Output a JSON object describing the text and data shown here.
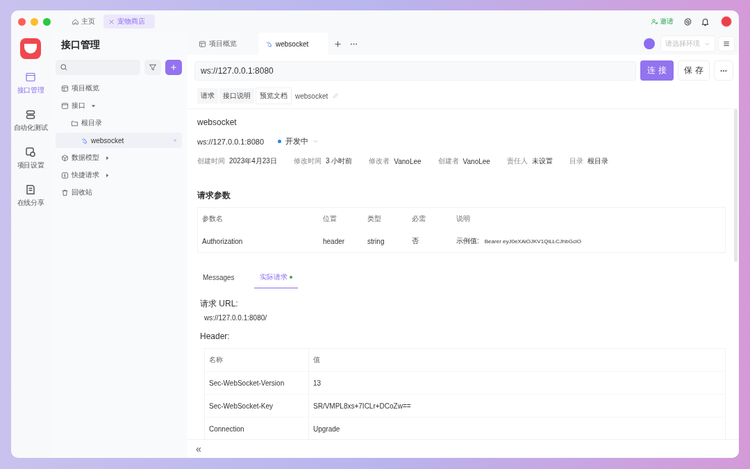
{
  "window_tabs": [
    {
      "label": "主页",
      "kind": "home",
      "selected": false
    },
    {
      "label": "宠物商店",
      "kind": "project",
      "selected": true
    }
  ],
  "header": {
    "invite": "邀请"
  },
  "rail": [
    {
      "label": "接口管理",
      "kind": "api",
      "selected": true
    },
    {
      "label": "自动化测试",
      "kind": "test",
      "selected": false
    },
    {
      "label": "项目设置",
      "kind": "settings",
      "selected": false
    },
    {
      "label": "在线分享",
      "kind": "share",
      "selected": false
    }
  ],
  "sidebar": {
    "title": "接口管理",
    "tree": [
      {
        "label": "项目概览",
        "kind": "overview",
        "selected": false
      },
      {
        "label": "接口",
        "kind": "api",
        "selected": false,
        "expanded": true,
        "children": [
          {
            "label": "根目录",
            "kind": "folder",
            "selected": false,
            "children": [
              {
                "label": "websocket",
                "kind": "websocket",
                "selected": true
              }
            ]
          }
        ]
      },
      {
        "label": "数据模型",
        "kind": "model",
        "selected": false,
        "expanded": false
      },
      {
        "label": "快捷请求",
        "kind": "quick",
        "selected": false,
        "expanded": false
      },
      {
        "label": "回收站",
        "kind": "trash",
        "selected": false
      }
    ]
  },
  "editor_tabs": [
    {
      "label": "项目概览",
      "kind": "overview",
      "selected": false
    },
    {
      "label": "websocket",
      "kind": "websocket",
      "selected": true
    }
  ],
  "environment": {
    "placeholder": "请选择环境"
  },
  "url": "ws://127.0.0.1:8080",
  "buttons": {
    "connect": "连 接",
    "save": "保 存"
  },
  "sub_tabs": [
    {
      "label": "请求",
      "selected": false
    },
    {
      "label": "接口说明",
      "selected": false
    },
    {
      "label": "预览文档",
      "selected": true
    }
  ],
  "endpoint_name": "websocket",
  "doc": {
    "title": "websocket",
    "url": "ws://127.0.0.1:8080",
    "status": {
      "label": "开发中",
      "color": "#1e88e5"
    },
    "meta": [
      {
        "label": "创建时间",
        "value": "2023年4月23日"
      },
      {
        "label": "修改时间",
        "value": "3 小时前"
      },
      {
        "label": "修改者",
        "value": "VanoLee"
      },
      {
        "label": "创建者",
        "value": "VanoLee"
      },
      {
        "label": "责任人",
        "value": "未设置"
      },
      {
        "label": "目录",
        "value": "根目录"
      }
    ]
  },
  "params": {
    "title": "请求参数",
    "columns": [
      "参数名",
      "位置",
      "类型",
      "必需",
      "说明"
    ],
    "rows": [
      {
        "name": "Authorization",
        "location": "header",
        "type": "string",
        "required": "否",
        "example_label": "示例值:",
        "example": "Bearer eyJ0eXAiOJKV1QiLLCJhbGciO"
      }
    ]
  },
  "result_tabs": [
    {
      "label": "Messages",
      "selected": false,
      "dot": false
    },
    {
      "label": "实际请求",
      "selected": true,
      "dot": true
    }
  ],
  "request": {
    "url_label": "请求 URL:",
    "url": "ws://127.0.0.1:8080/",
    "header_label": "Header:",
    "columns": [
      "名称",
      "值"
    ],
    "rows": [
      {
        "name": "Sec-WebSocket-Version",
        "value": "13"
      },
      {
        "name": "Sec-WebSocket-Key",
        "value": "SR/VMPL8xs+7ICLr+DCoZw=="
      },
      {
        "name": "Connection",
        "value": "Upgrade"
      }
    ]
  },
  "footer": {
    "collapse": "«"
  }
}
